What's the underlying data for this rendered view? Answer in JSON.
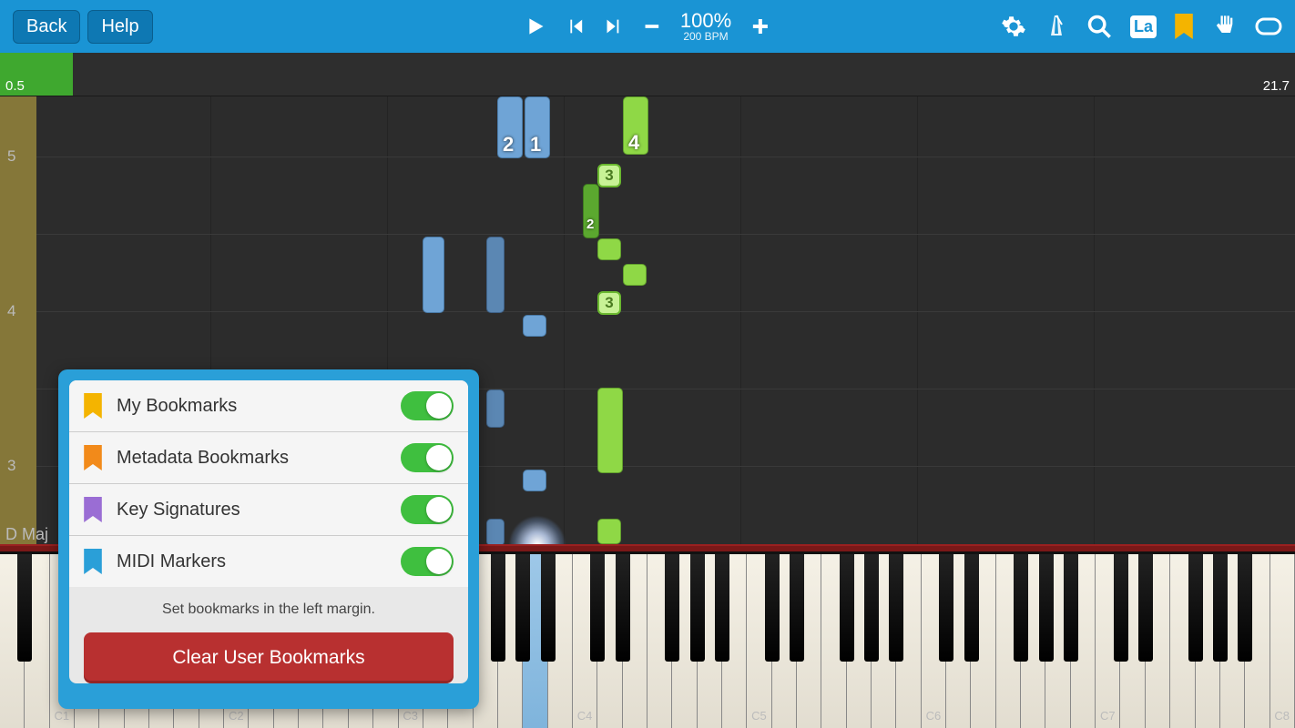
{
  "nav": {
    "back": "Back",
    "help": "Help"
  },
  "playback": {
    "percent": "100%",
    "bpm": "200 BPM"
  },
  "toolbar": {
    "la": "La"
  },
  "timeline": {
    "left": "0.5",
    "right": "21.7"
  },
  "measures": {
    "m5": "5",
    "m4": "4",
    "m3": "3",
    "keysig": "D Maj"
  },
  "fingers": {
    "n2": "2",
    "n1": "1",
    "n4": "4",
    "n3a": "3",
    "n2b": "2",
    "n3b": "3"
  },
  "octaves": [
    "C1",
    "C2",
    "C3",
    "C4",
    "C5",
    "C6",
    "C7",
    "C8"
  ],
  "popup": {
    "rows": [
      {
        "label": "My Bookmarks",
        "color": "#f4b400"
      },
      {
        "label": "Metadata Bookmarks",
        "color": "#f28a1a"
      },
      {
        "label": "Key Signatures",
        "color": "#9a6dd4"
      },
      {
        "label": "MIDI Markers",
        "color": "#2a9fd8"
      }
    ],
    "hint": "Set bookmarks in the left margin.",
    "clear": "Clear User Bookmarks"
  }
}
